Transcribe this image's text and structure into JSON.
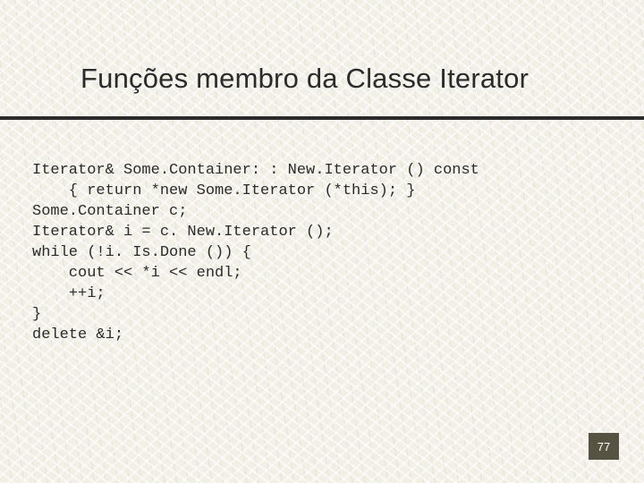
{
  "title": "Funções membro da Classe Iterator",
  "code_lines": [
    "Iterator& Some.Container: : New.Iterator () const",
    "    { return *new Some.Iterator (*this); }",
    "Some.Container c;",
    "Iterator& i = c. New.Iterator ();",
    "while (!i. Is.Done ()) {",
    "    cout << *i << endl;",
    "    ++i;",
    "}",
    "delete &i;"
  ],
  "page_number": "77"
}
